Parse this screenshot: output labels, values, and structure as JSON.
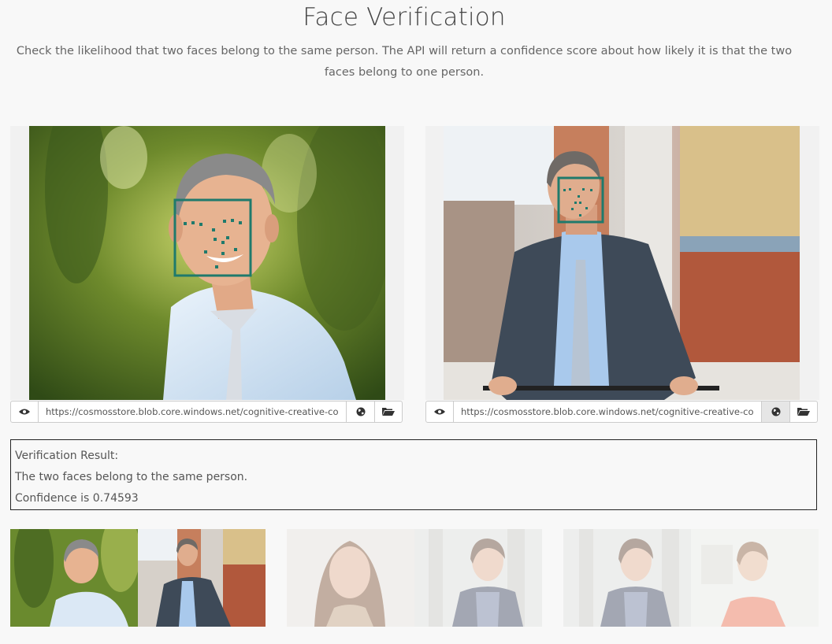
{
  "header": {
    "title": "Face Verification",
    "description": "Check the likelihood that two faces belong to the same person. The API will return a confidence score about how likely it is that the two faces belong to one person."
  },
  "panels": [
    {
      "image_subject": "man-in-light-blue-shirt-outdoor-portrait",
      "url": "https://cosmosstore.blob.core.windows.net/cognitive-creative-cont",
      "icons": [
        "eye-icon",
        "globe-icon",
        "folder-open-icon"
      ],
      "globe_active": false
    },
    {
      "image_subject": "man-in-suit-riding-bicycle",
      "url": "https://cosmosstore.blob.core.windows.net/cognitive-creative-cont",
      "icons": [
        "eye-icon",
        "globe-icon",
        "folder-open-icon"
      ],
      "globe_active": true
    }
  ],
  "result": {
    "heading": "Verification Result:",
    "message": "The two faces belong to the same person.",
    "confidence": "Confidence is 0.74593"
  },
  "examples": [
    {
      "name": "example-pair-1",
      "selected": true
    },
    {
      "name": "example-pair-2",
      "selected": false
    },
    {
      "name": "example-pair-3",
      "selected": false
    }
  ],
  "colors": {
    "face_box": "#1f7a6c",
    "background": "#f8f8f8",
    "text": "#555555"
  }
}
